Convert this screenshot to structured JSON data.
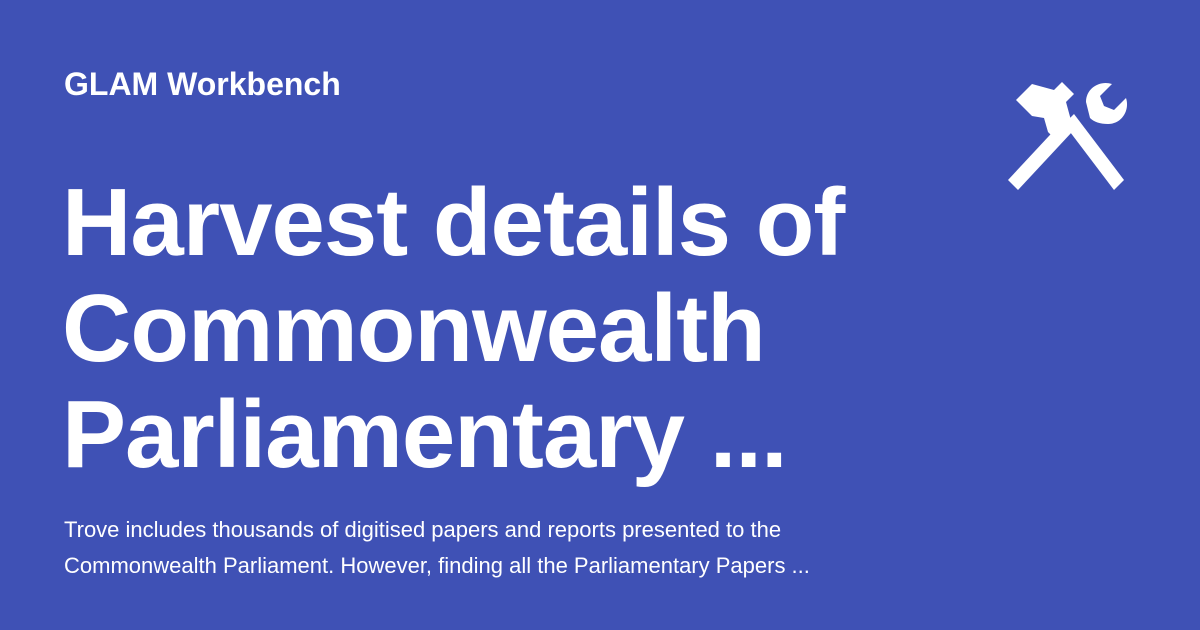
{
  "site_name": "GLAM Workbench",
  "title": "Harvest details of Commonwealth Parliamentary ...",
  "description": "Trove includes thousands of digitised papers and reports presented to the Commonwealth Parliament. However, finding all the Parliamentary Papers ...",
  "logo_icon": "hammer-wrench-icon",
  "colors": {
    "background": "#3F51B5",
    "text": "#FFFFFF"
  }
}
